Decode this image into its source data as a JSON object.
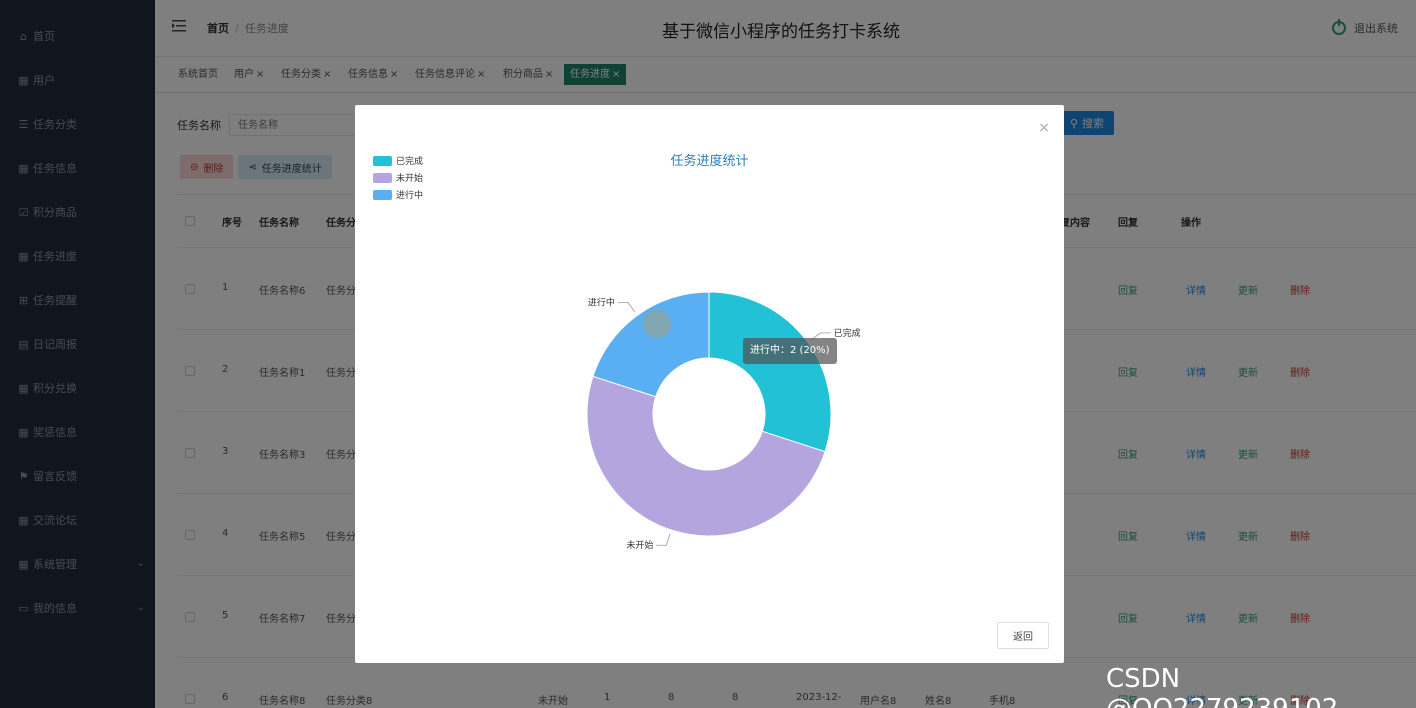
{
  "sidebar": {
    "items": [
      {
        "label": "首页",
        "icon": "home-icon"
      },
      {
        "label": "用户",
        "icon": "grid-icon"
      },
      {
        "label": "任务分类",
        "icon": "sliders-icon"
      },
      {
        "label": "任务信息",
        "icon": "grid-icon"
      },
      {
        "label": "积分商品",
        "icon": "check-square-icon"
      },
      {
        "label": "任务进度",
        "icon": "grid-icon"
      },
      {
        "label": "任务提醒",
        "icon": "apps-icon"
      },
      {
        "label": "日记周报",
        "icon": "document-icon"
      },
      {
        "label": "积分兑换",
        "icon": "grid-icon"
      },
      {
        "label": "奖惩信息",
        "icon": "grid-icon"
      },
      {
        "label": "留言反馈",
        "icon": "flag-icon"
      },
      {
        "label": "交流论坛",
        "icon": "grid-icon"
      },
      {
        "label": "系统管理",
        "icon": "grid-icon"
      },
      {
        "label": "我的信息",
        "icon": "card-icon"
      }
    ]
  },
  "header": {
    "breadcrumb_home": "首页",
    "breadcrumb_sep": "/",
    "breadcrumb_current": "任务进度",
    "system_title": "基于微信小程序的任务打卡系统",
    "logout_label": "退出系统"
  },
  "tabs": [
    {
      "label": "系统首页",
      "close": ""
    },
    {
      "label": "用户",
      "close": "×"
    },
    {
      "label": "任务分类",
      "close": "×"
    },
    {
      "label": "任务信息",
      "close": "×"
    },
    {
      "label": "任务信息评论",
      "close": "×"
    },
    {
      "label": "积分商品",
      "close": "×"
    },
    {
      "label": "任务进度",
      "close": "×"
    }
  ],
  "search": {
    "label": "任务名称",
    "placeholder": "任务名称",
    "button": "搜索"
  },
  "actions": {
    "delete": "删除",
    "stats": "任务进度统计"
  },
  "table": {
    "headers": {
      "index": "序号",
      "name": "任务名称",
      "category": "任务分",
      "reply_content": "复内容",
      "reply": "回复",
      "ops": "操作"
    },
    "rows": [
      {
        "index": "1",
        "name": "任务名称6",
        "category": "任务分"
      },
      {
        "index": "2",
        "name": "任务名称1",
        "category": "任务分"
      },
      {
        "index": "3",
        "name": "任务名称3",
        "category": "任务分"
      },
      {
        "index": "4",
        "name": "任务名称5",
        "category": "任务分"
      },
      {
        "index": "5",
        "name": "任务名称7",
        "category": "任务分"
      },
      {
        "index": "6",
        "name": "任务名称8",
        "category": "任务分类8",
        "status": "未开始",
        "c1": "1",
        "c2": "8",
        "c3": "8",
        "date": "2023-12-",
        "user": "用户名8",
        "person": "姓名8",
        "phone": "手机8"
      }
    ],
    "reply_label": "回复",
    "detail_label": "详情",
    "update_label": "更新",
    "delete_label": "删除"
  },
  "dialog": {
    "close": "×",
    "back_button": "返回",
    "tooltip": "进行中：2 (20%)"
  },
  "chart_data": {
    "type": "pie",
    "title": "任务进度统计",
    "categories": [
      "已完成",
      "未开始",
      "进行中"
    ],
    "values": [
      3,
      5,
      2
    ],
    "colors": [
      "#22c1d6",
      "#b5a5de",
      "#5aaef2"
    ],
    "legend_position": "top-left",
    "donut": true
  },
  "watermark": "CSDN @QQ2279239102"
}
